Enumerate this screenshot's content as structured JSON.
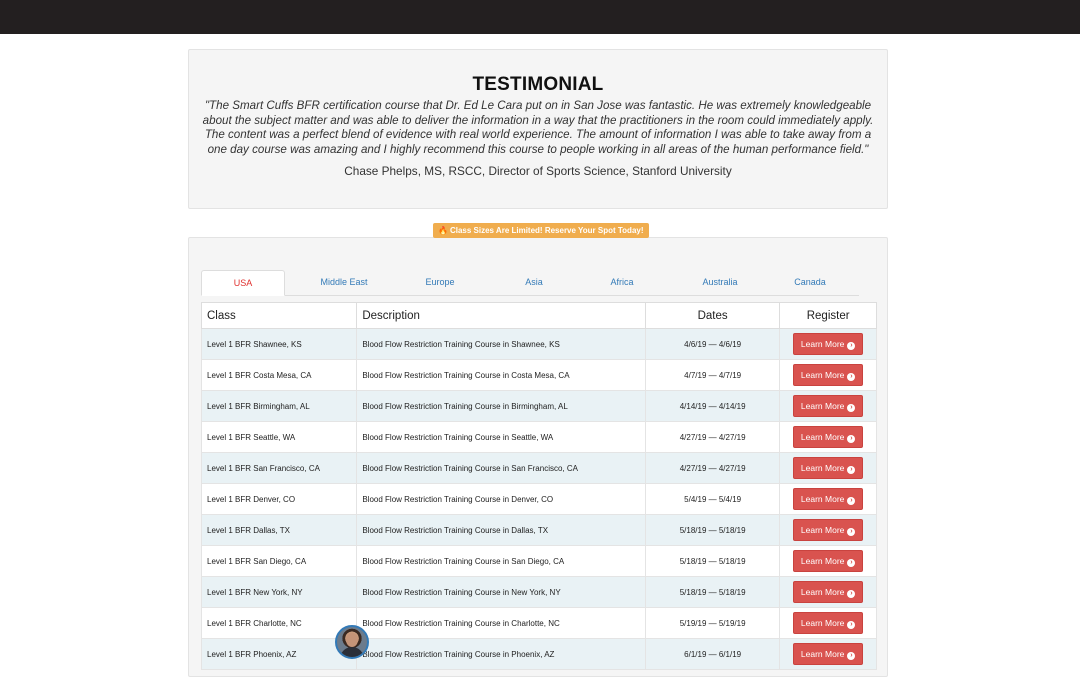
{
  "testimonial": {
    "title": "TESTIMONIAL",
    "quote": "\"The Smart Cuffs BFR certification course that Dr. Ed Le Cara put on in San Jose was fantastic. He was extremely knowledgeable about the subject matter and was able to deliver the information in a way that the practitioners in the room could immediately apply. The content was a perfect blend of evidence with real world experience. The amount of information I was able to take away from a one day course was amazing and I highly recommend this course to people working in all areas of the human performance field.\"",
    "author": "Chase Phelps, MS, RSCC, Director of Sports Science, Stanford University"
  },
  "promo": {
    "icon": "fire-icon",
    "text": "Class Sizes Are Limited! Reserve Your Spot Today!"
  },
  "tabs": [
    {
      "label": "USA",
      "active": true
    },
    {
      "label": "Middle East",
      "active": false
    },
    {
      "label": "Europe",
      "active": false
    },
    {
      "label": "Asia",
      "active": false
    },
    {
      "label": "Africa",
      "active": false
    },
    {
      "label": "Australia",
      "active": false
    },
    {
      "label": "Canada",
      "active": false
    }
  ],
  "table": {
    "headers": {
      "class": "Class",
      "description": "Description",
      "dates": "Dates",
      "register": "Register"
    },
    "button_label": "Learn More",
    "rows": [
      {
        "class": "Level 1 BFR Shawnee, KS",
        "description": "Blood Flow Restriction Training Course in Shawnee, KS",
        "dates": "4/6/19 — 4/6/19"
      },
      {
        "class": "Level 1 BFR Costa Mesa, CA",
        "description": "Blood Flow Restriction Training Course in Costa Mesa, CA",
        "dates": "4/7/19 — 4/7/19"
      },
      {
        "class": "Level 1 BFR Birmingham, AL",
        "description": "Blood Flow Restriction Training Course in Birmingham, AL",
        "dates": "4/14/19 — 4/14/19"
      },
      {
        "class": "Level 1 BFR Seattle, WA",
        "description": "Blood Flow Restriction Training Course in Seattle, WA",
        "dates": "4/27/19 — 4/27/19"
      },
      {
        "class": "Level 1 BFR San Francisco, CA",
        "description": "Blood Flow Restriction Training Course in San Francisco, CA",
        "dates": "4/27/19 — 4/27/19"
      },
      {
        "class": "Level 1 BFR Denver, CO",
        "description": "Blood Flow Restriction Training Course in Denver, CO",
        "dates": "5/4/19 — 5/4/19"
      },
      {
        "class": "Level 1 BFR Dallas, TX",
        "description": "Blood Flow Restriction Training Course in Dallas, TX",
        "dates": "5/18/19 — 5/18/19"
      },
      {
        "class": "Level 1 BFR San Diego, CA",
        "description": "Blood Flow Restriction Training Course in San Diego, CA",
        "dates": "5/18/19 — 5/18/19"
      },
      {
        "class": "Level 1 BFR New York, NY",
        "description": "Blood Flow Restriction Training Course in New York, NY",
        "dates": "5/18/19 — 5/18/19"
      },
      {
        "class": "Level 1 BFR Charlotte, NC",
        "description": "Blood Flow Restriction Training Course in Charlotte, NC",
        "dates": "5/19/19 — 5/19/19"
      },
      {
        "class": "Level 1 BFR Phoenix, AZ",
        "description": "Blood Flow Restriction Training Course in Phoenix, AZ",
        "dates": "6/1/19 — 6/1/19"
      }
    ]
  },
  "colors": {
    "topbar": "#231f20",
    "button": "#d9534f",
    "promo": "#f0ad4e",
    "active_tab": "#e0302e",
    "link": "#337ab7"
  }
}
